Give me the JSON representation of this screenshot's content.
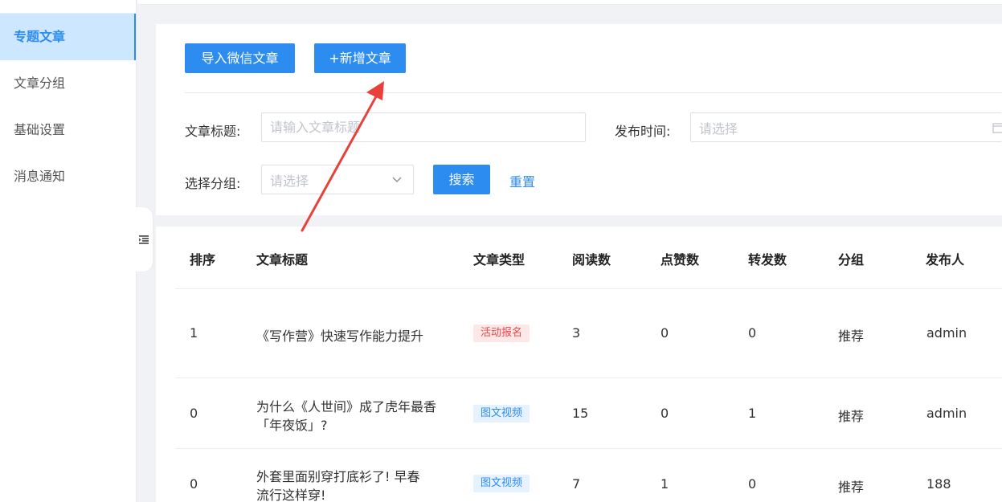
{
  "sidebar": {
    "items": [
      {
        "label": "专题文章"
      },
      {
        "label": "文章分组"
      },
      {
        "label": "基础设置"
      },
      {
        "label": "消息通知"
      }
    ]
  },
  "toolbar": {
    "import_label": "导入微信文章",
    "add_label": "+新增文章"
  },
  "filters": {
    "title_label": "文章标题:",
    "title_placeholder": "请输入文章标题",
    "time_label": "发布时间:",
    "time_placeholder": "请选择",
    "group_label": "选择分组:",
    "group_placeholder": "请选择",
    "search_label": "搜索",
    "reset_label": "重置"
  },
  "table": {
    "headers": [
      "排序",
      "文章标题",
      "文章类型",
      "阅读数",
      "点赞数",
      "转发数",
      "分组",
      "发布人"
    ],
    "rows": [
      {
        "order": "1",
        "title_lines": [
          "《写作营》快速写作能力提升"
        ],
        "type": "活动报名",
        "type_color": "#e5484d",
        "reads": "3",
        "likes": "0",
        "shares": "0",
        "group": "推荐",
        "publisher": "admin"
      },
      {
        "order": "0",
        "title_lines": [
          "为什么《人世间》成了虎年最香",
          "「年夜饭」?"
        ],
        "type": "图文视频",
        "type_color": "#2d8cf0",
        "reads": "15",
        "likes": "0",
        "shares": "1",
        "group": "推荐",
        "publisher": "admin"
      },
      {
        "order": "0",
        "title_lines": [
          "外套里面别穿打底衫了! 早春",
          "流行这样穿!"
        ],
        "type": "图文视频",
        "type_color": "#2d8cf0",
        "reads": "7",
        "likes": "1",
        "shares": "0",
        "group": "推荐",
        "publisher": "188"
      }
    ]
  },
  "colors": {
    "accent": "#2d8cf0",
    "active_nav_bg": "#cce7ff",
    "annotation_arrow": "#e8413c"
  },
  "icons": {
    "collapse": "indent-icon",
    "select_caret": "chevron-down-icon",
    "date_picker": "calendar-icon"
  }
}
